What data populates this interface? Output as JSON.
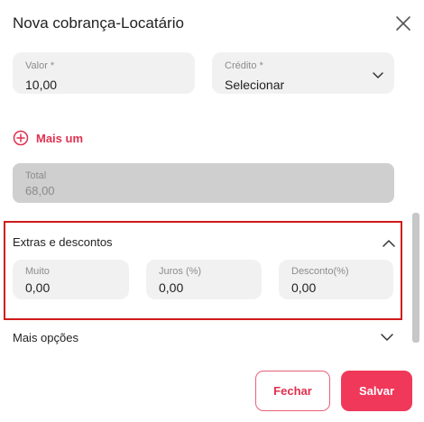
{
  "modal": {
    "title": "Nova cobrança-Locatário"
  },
  "form": {
    "valor": {
      "label": "Valor *",
      "value": "10,00"
    },
    "credito": {
      "label": "Crédito *",
      "value": "Selecionar"
    },
    "add_more_label": "Mais um",
    "total": {
      "label": "Total",
      "value": "68,00"
    }
  },
  "extras": {
    "title": "Extras e descontos",
    "expanded": true,
    "fields": [
      {
        "label": "Muito",
        "value": "0,00"
      },
      {
        "label": "Juros (%)",
        "value": "0,00"
      },
      {
        "label": "Desconto(%)",
        "value": "0,00"
      }
    ]
  },
  "more_options": {
    "title": "Mais opções",
    "expanded": false
  },
  "actions": {
    "close_label": "Fechar",
    "save_label": "Salvar"
  },
  "colors": {
    "accent": "#f0385a",
    "accent_text": "#e0304f",
    "highlight_border": "#d11a1a",
    "field_bg": "#f1f1f1",
    "disabled_bg": "#cfcfcf"
  },
  "icons": {
    "close": "close-icon",
    "add": "plus-circle-icon",
    "dropdown": "chevron-down-icon",
    "collapse": "chevron-up-icon"
  }
}
